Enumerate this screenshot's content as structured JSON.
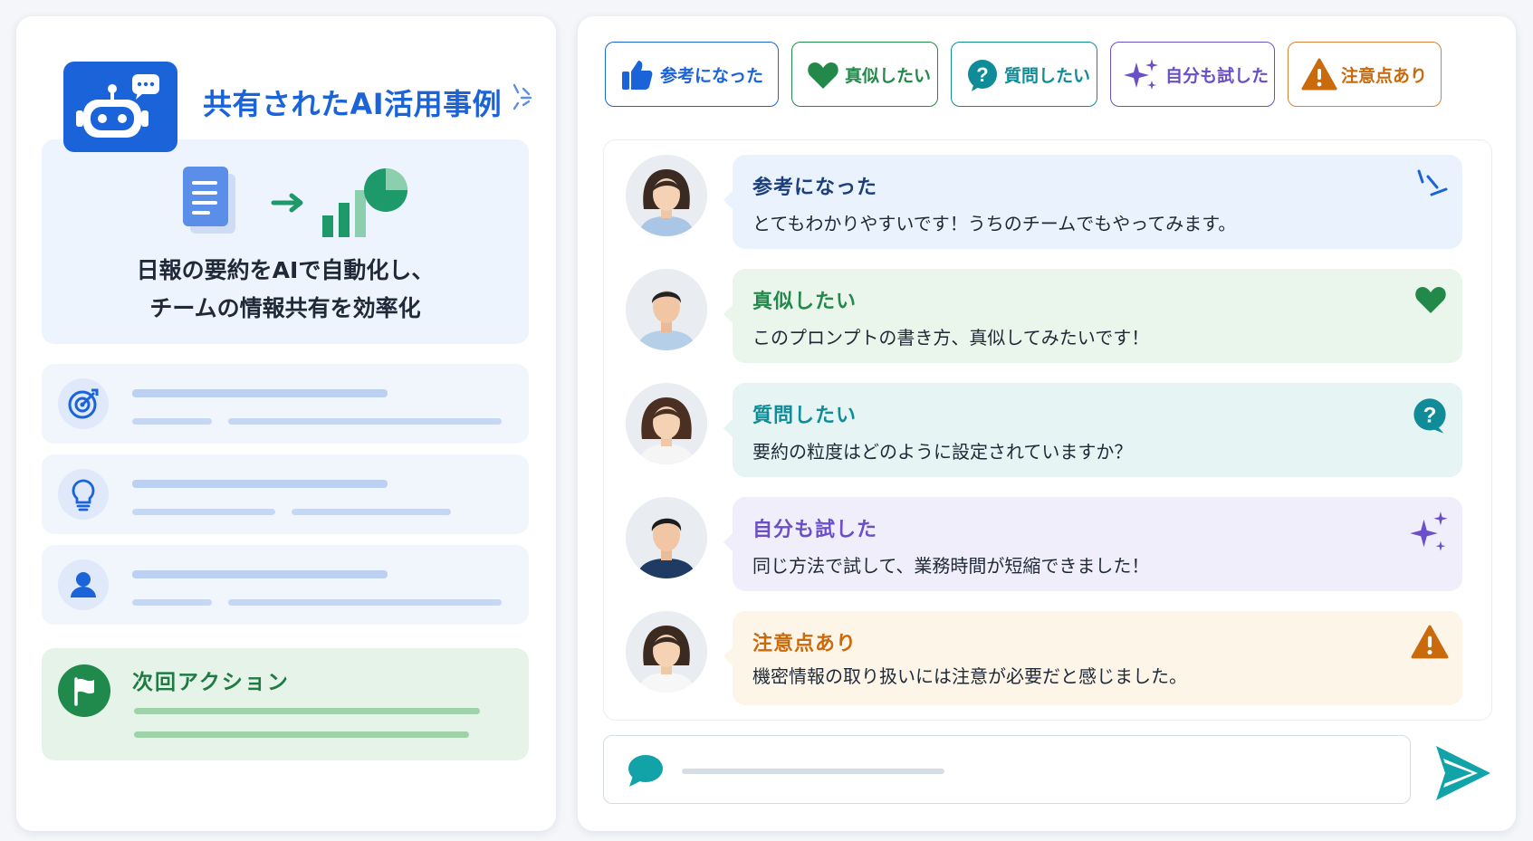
{
  "left": {
    "title": "共有されたAI活用事例",
    "summary_line1": "日報の要約をAIで自動化し、",
    "summary_line2": "チームの情報共有を効率化",
    "info_icons": [
      "target-icon",
      "lightbulb-icon",
      "person-icon"
    ],
    "next_action_label": "次回アクション"
  },
  "reactions": [
    {
      "label": "参考になった",
      "icon": "thumbs-up-icon",
      "color": "#1b63d8"
    },
    {
      "label": "真似したい",
      "icon": "heart-icon",
      "color": "#22894a"
    },
    {
      "label": "質問したい",
      "icon": "question-icon",
      "color": "#0f8c97"
    },
    {
      "label": "自分も試した",
      "icon": "sparkle-icon",
      "color": "#6b4fc8"
    },
    {
      "label": "注意点あり",
      "icon": "warning-icon",
      "color": "#c96a0c"
    }
  ],
  "comments": [
    {
      "title": "参考になった",
      "text": "とてもわかりやすいです！うちのチームでもやってみます。",
      "icon": "burst-icon",
      "color": "#1b3f7a",
      "bg": "#eaf2fd",
      "avatar": "woman"
    },
    {
      "title": "真似したい",
      "text": "このプロンプトの書き方、真似してみたいです！",
      "icon": "heart-icon",
      "color": "#22894a",
      "bg": "#eaf5ec",
      "avatar": "man"
    },
    {
      "title": "質問したい",
      "text": "要約の粒度はどのように設定されていますか？",
      "icon": "question-icon",
      "color": "#0f8c97",
      "bg": "#e6f5f4",
      "avatar": "woman"
    },
    {
      "title": "自分も試した",
      "text": "同じ方法で試して、業務時間が短縮できました！",
      "icon": "sparkle-icon",
      "color": "#6b4fc8",
      "bg": "#f1eefb",
      "avatar": "man"
    },
    {
      "title": "注意点あり",
      "text": "機密情報の取り扱いには注意が必要だと感じました。",
      "icon": "warning-icon",
      "color": "#c96a0c",
      "bg": "#fdf5e8",
      "avatar": "woman"
    }
  ],
  "colors": {
    "accent": "#1b63d8",
    "send": "#12a3a8"
  }
}
